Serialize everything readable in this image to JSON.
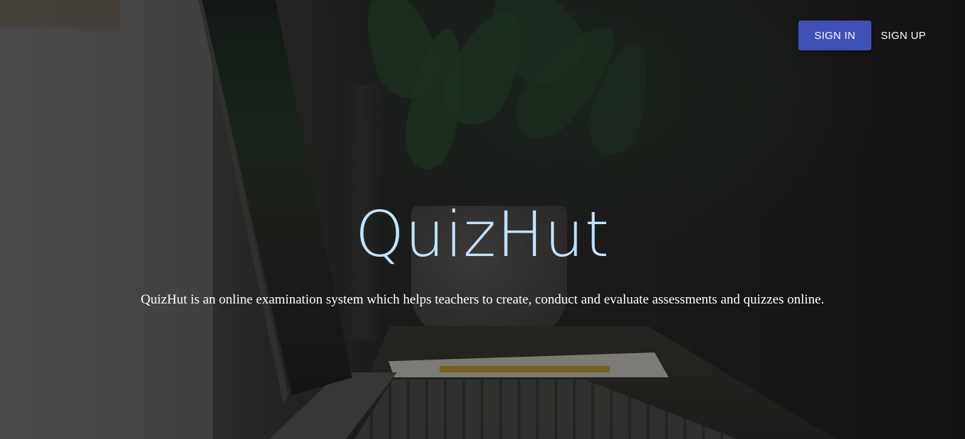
{
  "header": {
    "signin_label": "SIGN IN",
    "signup_label": "SIGN UP"
  },
  "hero": {
    "title": "QuizHut",
    "tagline": "QuizHut is an online examination system which helps teachers to create, conduct and evaluate assessments and quizzes online."
  },
  "colors": {
    "primary": "#3f51b5",
    "title": "#bfe3ff",
    "text": "#ffffff"
  }
}
